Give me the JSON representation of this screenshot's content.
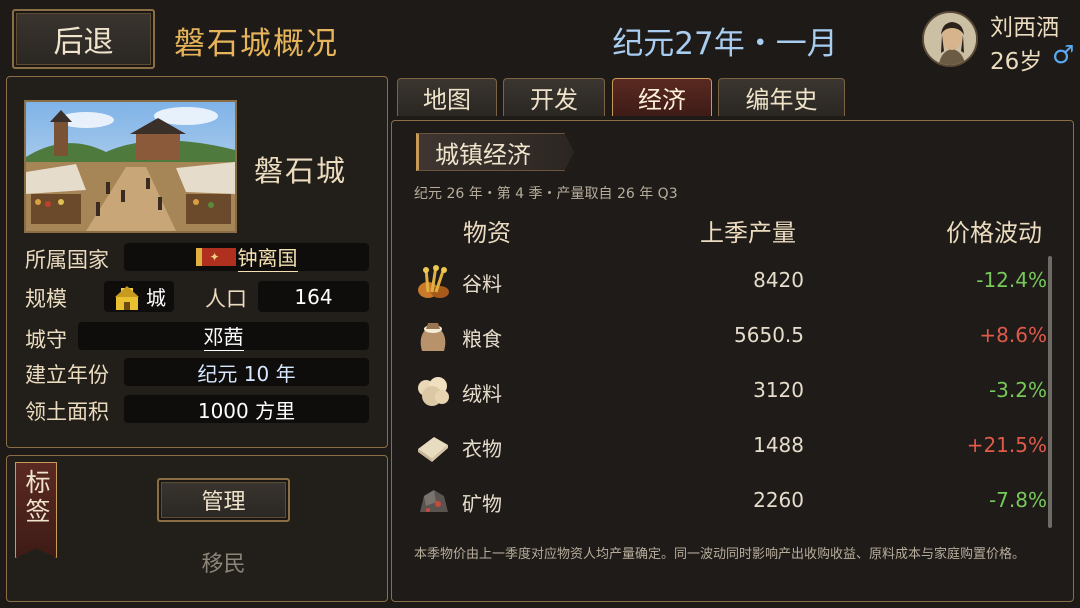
{
  "header": {
    "back_label": "后退",
    "page_title": "磐石城概况",
    "date": "纪元27年・一月",
    "player_name": "刘西洒",
    "player_age": "26岁",
    "gender_symbol": "♂"
  },
  "city": {
    "name": "磐石城",
    "info": [
      {
        "label": "所属国家",
        "value": "钟离国"
      },
      {
        "label": "规模",
        "value": "城"
      },
      {
        "label": "人口",
        "value": "164"
      },
      {
        "label": "城守",
        "value": "邓茜"
      },
      {
        "label": "建立年份",
        "value": "纪元 10 年"
      },
      {
        "label": "领土面积",
        "value": "1000 方里"
      }
    ]
  },
  "tags": {
    "title": "标签",
    "manage_label": "管理",
    "items": [
      "移民"
    ]
  },
  "tabs": [
    {
      "label": "地图",
      "active": false
    },
    {
      "label": "开发",
      "active": false
    },
    {
      "label": "经济",
      "active": true
    },
    {
      "label": "编年史",
      "active": false
    }
  ],
  "economy": {
    "title": "城镇经济",
    "subtitle": "纪元 26 年・第 4 季・产量取自 26 年 Q3",
    "columns": [
      "物资",
      "上季产量",
      "价格波动"
    ],
    "rows": [
      {
        "icon": "grain-icon",
        "name": "谷料",
        "output": "8420",
        "change": "-12.4%",
        "dir": "neg"
      },
      {
        "icon": "food-sack-icon",
        "name": "粮食",
        "output": "5650.5",
        "change": "+8.6%",
        "dir": "pos"
      },
      {
        "icon": "wool-icon",
        "name": "绒料",
        "output": "3120",
        "change": "-3.2%",
        "dir": "neg"
      },
      {
        "icon": "cloth-icon",
        "name": "衣物",
        "output": "1488",
        "change": "+21.5%",
        "dir": "pos"
      },
      {
        "icon": "ore-icon",
        "name": "矿物",
        "output": "2260",
        "change": "-7.8%",
        "dir": "neg"
      }
    ],
    "footnote": "本季物价由上一季度对应物资人均产量确定。同一波动同时影响产出收购收益、原料成本与家庭购置价格。"
  },
  "colors": {
    "accent": "#8a6e46",
    "increase": "#e05a4a",
    "decrease": "#78c85a",
    "date": "#a8cdf0"
  }
}
